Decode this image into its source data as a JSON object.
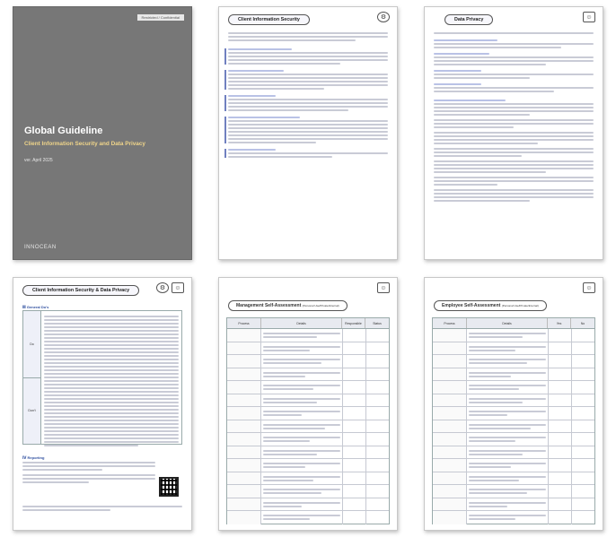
{
  "cover": {
    "tag": "Restricted / Confidential",
    "title": "Global Guideline",
    "subtitle": "Client Information Security and Data Privacy",
    "version": "ver. April 2025",
    "brand": "INNOCEAN"
  },
  "page2": {
    "heading": "Client Information Security"
  },
  "page3": {
    "heading": "Data Privacy"
  },
  "page4": {
    "heading": "Client Information Security & Data Privacy",
    "section1": "Ⅲ General Do's",
    "section2": "Ⅳ Reporting",
    "rowA": "Do",
    "rowB": "Don't"
  },
  "page5": {
    "title": "Management Self-Assessment",
    "title_note": "(Personal Use/Private/Internal)",
    "col1": "Process",
    "col2": "Details",
    "col3": "Responsible",
    "col4": "Status"
  },
  "page6": {
    "title": "Employee Self-Assessment",
    "title_note": "(Personal Use/Private/Internal)",
    "col1": "Process",
    "col2": "Details",
    "col3": "Yes",
    "col4": "No"
  },
  "icons": {
    "lock": "⌂",
    "person": "☺"
  }
}
